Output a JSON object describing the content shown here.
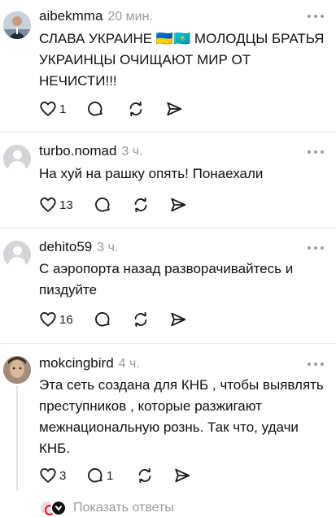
{
  "comments": [
    {
      "username": "aibekmma",
      "time": "20 мин.",
      "text_lines": [
        "СЛАВА УКРАИНЕ 🇺🇦🇰🇿 МОЛОДЦЫ БРАТЬЯ",
        "УКРАИНЦЫ ОЧИЩАЮТ МИР ОТ",
        "НЕЧИСТИ!!!"
      ],
      "likes": "1",
      "replies": ""
    },
    {
      "username": "turbo.nomad",
      "time": "3 ч.",
      "text_lines": [
        "На хуй на рашку опять! Понаехали"
      ],
      "likes": "13",
      "replies": ""
    },
    {
      "username": "dehito59",
      "time": "3 ч.",
      "text_lines": [
        "С аэропорта назад разворачивайтесь и",
        "пиздуйте"
      ],
      "likes": "16",
      "replies": ""
    },
    {
      "username": "mokcingbird",
      "time": "4 ч.",
      "text_lines": [
        "Эта сеть создана для КНБ , чтобы выявлять",
        "преступников , которые разжигают",
        "межнациональную рознь. Так что, удачи",
        "КНБ."
      ],
      "likes": "3",
      "replies": "1"
    }
  ],
  "show_replies_label": "Показать ответы",
  "icons": {
    "like": "heart-icon",
    "reply": "comment-bubble-icon",
    "repost": "repost-icon",
    "share": "send-icon",
    "more": "more-dots-icon"
  },
  "colors": {
    "muted": "#9b9b9b",
    "icon": "#1a1a1a",
    "divider": "#e6e6e6"
  }
}
